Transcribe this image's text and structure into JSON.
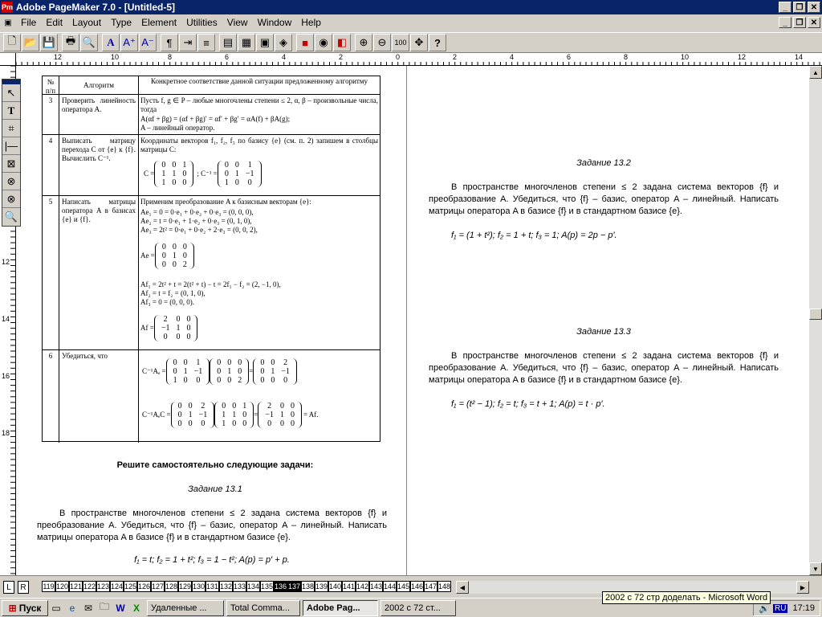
{
  "window": {
    "title": "Adobe PageMaker 7.0 - [Untitled-5]",
    "app_icon": "pagemaker-icon"
  },
  "menu": [
    "File",
    "Edit",
    "Layout",
    "Type",
    "Element",
    "Utilities",
    "View",
    "Window",
    "Help"
  ],
  "toolbar_icons": [
    "new-icon",
    "open-icon",
    "save-icon",
    "print-icon",
    "find-icon",
    "text-a-icon",
    "text-size-up-icon",
    "text-size-down-icon",
    "paragraph-icon",
    "indent-icon",
    "text-icon",
    "place-icon",
    "table-icon",
    "picture-icon",
    "palette-icon",
    "color-icon",
    "globe-icon",
    "pdf-icon",
    "zoom-in-icon",
    "zoom-out-icon",
    "actual-size-icon",
    "fit-icon",
    "help-icon"
  ],
  "hruler_labels": [
    "12",
    "10",
    "8",
    "6",
    "4",
    "2",
    "0",
    "2",
    "4",
    "6",
    "8",
    "10",
    "12",
    "14"
  ],
  "vruler_labels": [
    "6",
    "8",
    "10",
    "12",
    "14",
    "16",
    "18"
  ],
  "table": {
    "header": {
      "num": "№ п/п",
      "algo": "Алгоритм",
      "desc": "Конкретное соответствие данной ситуации предложенному алгоритму"
    },
    "rows": [
      {
        "num": "3",
        "algo": "Проверить линейность оператора A.",
        "desc1": "Пусть f, g ∈ P – любые многочлены степени ≤ 2, α, β – произвольные числа, тогда",
        "desc2": "A(αf + βg) = (αf + βg)′ = αf′ + βg′ = αA(f) + βA(g);",
        "desc3": "A – линейный оператор."
      },
      {
        "num": "4",
        "algo": "Выписать матрицу перехода C от {e} к {f}. Вычислить C⁻¹.",
        "desc1": "Координаты векторов f₁, f₂, f₃ по базису {e} (см. п. 2) запишем в столбцы матрицы C:",
        "lbl1": "C =",
        "lbl2": "; C⁻¹ ="
      },
      {
        "num": "5",
        "algo": "Написать матрицы оператора A в базисах {e} и {f}.",
        "desc1": "Применим преобразование A к базисным векторам {e}:",
        "l1": "Ae₁ = 0 = 0·e₁ + 0·e₂ + 0·e₃ = (0, 0, 0),",
        "l2": "Ae₂ = t = 0·e₁ + 1·e₂ + 0·e₃ = (0, 1, 0),",
        "l3": "Ae₃ = 2t² = 0·e₁ + 0·e₂ + 2·e₃ = (0, 0, 2),",
        "lbl1": "Ae =",
        "l4": "Af₁ = 2t² + t = 2(t² + t) − t = 2f₁ − f₂ = (2, −1, 0),",
        "l5": "Af₂ = t = f₂ = (0, 1, 0),",
        "l6": "Af₃ = 0 = (0, 0, 0).",
        "lbl2": "Af ="
      },
      {
        "num": "6",
        "algo": "Убедиться, что",
        "lbl1": "C⁻¹Aₑ =",
        "lbl2": "C⁻¹AₑC =",
        "tail": "= Af."
      }
    ]
  },
  "left_text": {
    "heading": "Решите самостоятельно следующие задачи:",
    "task_title": "Задание 13.1",
    "para": "В пространстве многочленов степени ≤ 2 задана система векторов {f} и преобразование A. Убедиться, что {f} – базис, оператор A – линейный. Написать матрицы оператора A в базисе {f} и в стандартном базисе {e}.",
    "formula": "f₁ = t;   f₂ = 1 + t²;   f₃ = 1 − t²;   A(p) = p′ + p."
  },
  "right_text": [
    {
      "title": "Задание 13.2",
      "para": "В пространстве многочленов степени ≤ 2 задана система векторов {f} и преобразование A. Убедиться, что {f} – базис, оператор A – линейный. Написать матрицы оператора A в базисе {f} и в стандартном базисе {e}.",
      "formula": "f₁ = (1 + t²);   f₂ = 1 + t;   f₃ = 1;   A(p) = 2p − p′."
    },
    {
      "title": "Задание 13.3",
      "para": "В пространстве многочленов степени ≤ 2 задана система векторов {f} и преобразование A. Убедиться, что {f} – базис, оператор A – линейный. Написать матрицы оператора A в базисе {f} и в стандартном базисе {e}.",
      "formula": "f₁ = (t² − 1);   f₂ = t;   f₃ = t + 1;   A(p) = t · p′."
    }
  ],
  "pages": {
    "lr": [
      "L",
      "R"
    ],
    "list": [
      "119",
      "120",
      "121",
      "122",
      "123",
      "124",
      "125",
      "126",
      "127",
      "128",
      "129",
      "130",
      "131",
      "132",
      "133",
      "134",
      "135",
      "136",
      "137",
      "138",
      "139",
      "140",
      "141",
      "142",
      "143",
      "144",
      "145",
      "146",
      "147",
      "148"
    ],
    "active": [
      "136",
      "137"
    ]
  },
  "taskbar": {
    "start": "Пуск",
    "tasks": [
      "Удаленные ...",
      "Total Comma...",
      "Adobe Pag...",
      "2002 с 72 ст..."
    ],
    "active": "Adobe Pag...",
    "clock": "17:19",
    "lang": "RU",
    "tooltip": "2002 с 72 стр доделать - Microsoft Word"
  }
}
